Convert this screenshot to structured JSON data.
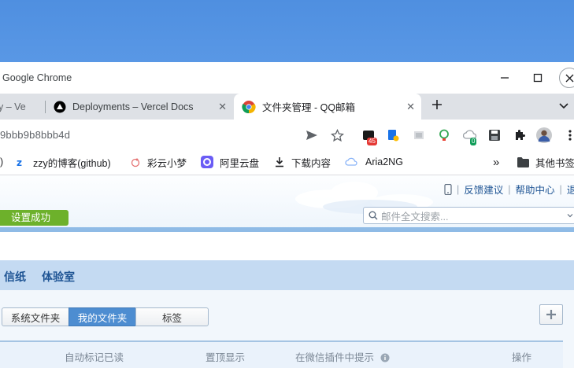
{
  "window": {
    "title": "Google Chrome",
    "controls": {
      "minimize": "—",
      "maximize": "☐",
      "close": "✕"
    }
  },
  "tabs": [
    {
      "label": "y – Ve",
      "active": false
    },
    {
      "label": "Deployments – Vercel Docs",
      "active": false
    },
    {
      "label": "文件夹管理 - QQ邮箱",
      "active": true
    }
  ],
  "toolbar": {
    "url": "9bbb9b8bbb4d",
    "extension_badges": {
      "mail": "45",
      "cloud": "0"
    }
  },
  "bookmarks": [
    {
      "label": ")"
    },
    {
      "label": "zzy的博客(github)"
    },
    {
      "label": "彩云小梦"
    },
    {
      "label": "阿里云盘"
    },
    {
      "label": "下载内容"
    },
    {
      "label": "Aria2NG"
    },
    {
      "label": "»"
    },
    {
      "label": "其他书签"
    }
  ],
  "qq": {
    "top_links": [
      "反馈建议",
      "帮助中心",
      "退出"
    ],
    "tip": "设置成功",
    "search_placeholder": "邮件全文搜索...",
    "nav": [
      "信纸",
      "体验室"
    ],
    "segments": [
      "系统文件夹",
      "我的文件夹",
      "标签"
    ],
    "active_segment": "我的文件夹",
    "table_headers": [
      "自动标记已读",
      "置顶显示",
      "在微信插件中提示",
      "操作"
    ]
  },
  "colors": {
    "tip_green": "#6db12b",
    "accent_blue": "#4d8dd1",
    "nav_blue": "#c4daf2",
    "link_blue": "#1e5494"
  }
}
